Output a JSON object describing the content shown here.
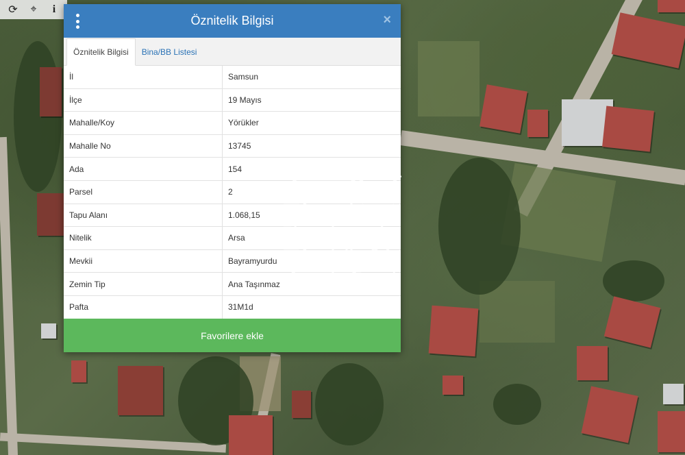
{
  "toolbar": {
    "tools": [
      {
        "icon": "refresh-icon",
        "glyph": "⟳"
      },
      {
        "icon": "locate-icon",
        "glyph": "⌖"
      },
      {
        "icon": "info-icon",
        "glyph": "i"
      }
    ]
  },
  "dialog": {
    "title": "Öznitelik Bilgisi",
    "close_glyph": "×",
    "tabs": [
      {
        "label": "Öznitelik Bilgisi",
        "active": true
      },
      {
        "label": "Bina/BB Listesi",
        "active": false
      }
    ],
    "rows": [
      {
        "key": "İl",
        "value": "Samsun"
      },
      {
        "key": "İlçe",
        "value": "19 Mayıs"
      },
      {
        "key": "Mahalle/Koy",
        "value": "Yörükler"
      },
      {
        "key": "Mahalle No",
        "value": "13745"
      },
      {
        "key": "Ada",
        "value": "154"
      },
      {
        "key": "Parsel",
        "value": "2"
      },
      {
        "key": "Tapu Alanı",
        "value": "1.068,15"
      },
      {
        "key": "Nitelik",
        "value": "Arsa"
      },
      {
        "key": "Mevkii",
        "value": "Bayramyurdu"
      },
      {
        "key": "Zemin Tip",
        "value": "Ana Taşınmaz"
      },
      {
        "key": "Pafta",
        "value": "31M1d"
      }
    ],
    "favorite_button": "Favorilere ekle"
  },
  "watermark": {
    "mark": "SM"
  },
  "colors": {
    "header": "#3a7ebf",
    "favorite": "#5cb85c",
    "tab_link": "#2a72b5"
  }
}
